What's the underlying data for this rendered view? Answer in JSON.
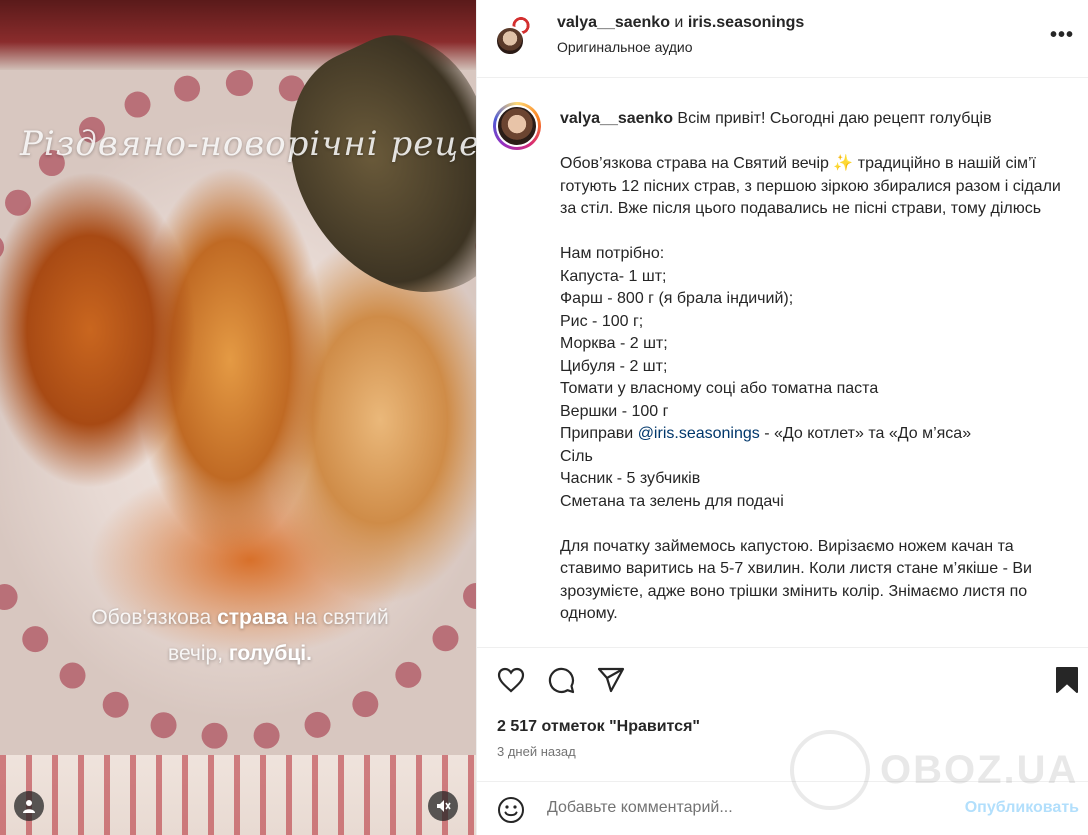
{
  "media": {
    "overlay_title": "Різдвяно-новорічні рецепти",
    "overlay_caption": {
      "part1": "Обов'язкова ",
      "bold1": "страва",
      "part2": " на святий",
      "part3": "вечір, ",
      "bold2": "голубці."
    }
  },
  "header": {
    "user1": "valya__saenko",
    "and": " и ",
    "user2": "iris.seasonings",
    "audio": "Оригинальное аудио",
    "more": "•••"
  },
  "caption": {
    "username": "valya__saenko",
    "intro": " Всім привіт! Сьогодні даю рецепт голубців",
    "paragraph1": "Обов’язкова страва на Святий вечір ✨ традиційно в нашій сім’ї готують 12 пісних страв, з першою зіркою збиралися разом і сідали за стіл. Вже після цього подавались не пісні страви, тому ділюсь",
    "needed_title": "Нам потрібно:",
    "ingredients": [
      "Капуста- 1 шт;",
      "Фарш - 800 г (я брала індичий);",
      "Рис - 100 г;",
      "Морква - 2 шт;",
      "Цибуля - 2 шт;",
      "Томати у власному соці або томатна паста",
      "Вершки - 100 г"
    ],
    "spices_prefix": "Приправи ",
    "spices_mention": "@iris.seasonings",
    "spices_suffix": " - «До котлет» та «До м’яса»",
    "ingredients_after": [
      "Сіль",
      "Часник - 5 зубчиків",
      "Сметана та зелень для подачі"
    ],
    "paragraph2": "Для початку займемось капустою. Вирізаємо ножем качан та ставимо варитись на 5-7 хвилин. Коли листя стане м’якіше - Ви зрозумієте, адже воно трішки змінить колір. Знімаємо листя по одному."
  },
  "actions": {
    "likes": "2 517 отметок \"Нравится\"",
    "time": "3 дней назад"
  },
  "comment": {
    "placeholder": "Добавьте комментарий...",
    "publish": "Опубликовать"
  },
  "watermark": "OBOZ.UA"
}
